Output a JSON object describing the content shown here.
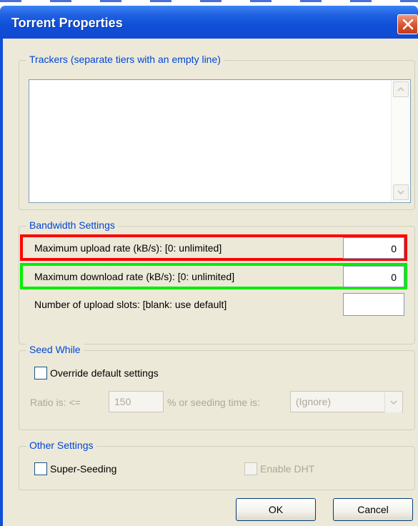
{
  "window": {
    "title": "Torrent Properties"
  },
  "trackers": {
    "legend": "Trackers (separate tiers with an empty line)",
    "text": ""
  },
  "bandwidth": {
    "legend": "Bandwidth Settings",
    "max_upload_label": "Maximum upload rate (kB/s): [0: unlimited]",
    "max_upload_value": "0",
    "max_download_label": "Maximum download rate (kB/s): [0: unlimited]",
    "max_download_value": "0",
    "upload_slots_label": "Number of upload slots: [blank: use default]",
    "upload_slots_value": ""
  },
  "seed_while": {
    "legend": "Seed While",
    "override_label": "Override default settings",
    "ratio_label": "Ratio is:  <=",
    "ratio_value": "150",
    "percent_or_label": "%  or seeding time is:",
    "seeding_time_value": "(Ignore)"
  },
  "other": {
    "legend": "Other Settings",
    "super_seeding_label": "Super-Seeding",
    "enable_dht_label": "Enable DHT"
  },
  "buttons": {
    "ok": "OK",
    "cancel": "Cancel"
  },
  "colors": {
    "title_bar": "#1f5fe0",
    "highlight_upload": "#ff0000",
    "highlight_download": "#00ee00",
    "legend_text": "#0046d5"
  },
  "icons": {
    "close": "close-icon",
    "scroll_up": "scroll-up-arrow-icon",
    "scroll_down": "scroll-down-arrow-icon",
    "dropdown": "chevron-down-icon"
  }
}
